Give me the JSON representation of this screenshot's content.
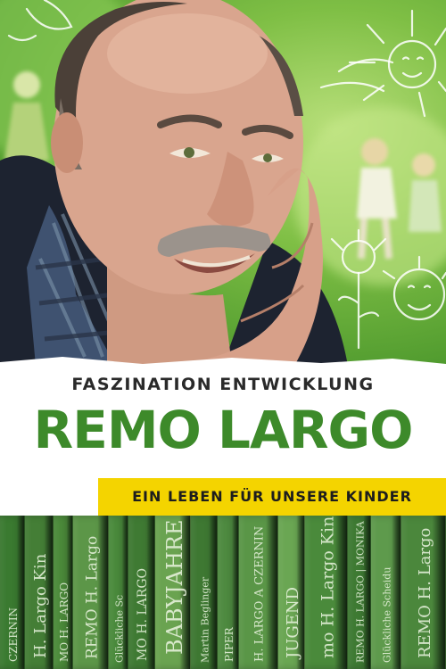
{
  "poster": {
    "supertitle": "FASZINATION ENTWICKLUNG",
    "title": "REMO LARGO",
    "tagline": "EIN LEBEN FÜR UNSERE KINDER"
  },
  "colors": {
    "title_green": "#3d8a2a",
    "tagline_yellow": "#f4d400",
    "background_green": "#6fb23c"
  },
  "books": [
    {
      "text": "CZERNIN"
    },
    {
      "text": "H. Largo  Kin"
    },
    {
      "text": "MO H. LARGO"
    },
    {
      "text": "REMO H. Largo"
    },
    {
      "text": "Glückliche Sc"
    },
    {
      "text": "MO H. LARGO"
    },
    {
      "text": "BABYJAHRE"
    },
    {
      "text": "Martin Beglinger"
    },
    {
      "text": "PIPER"
    },
    {
      "text": "H. LARGO  A CZERNIN"
    },
    {
      "text": "JUGEND"
    },
    {
      "text": "mo H. Largo  Kind"
    },
    {
      "text": "REMO H. LARGO | MONIKA"
    },
    {
      "text": "Glückliche Scheidu"
    },
    {
      "text": "REMO H. Largo"
    }
  ]
}
